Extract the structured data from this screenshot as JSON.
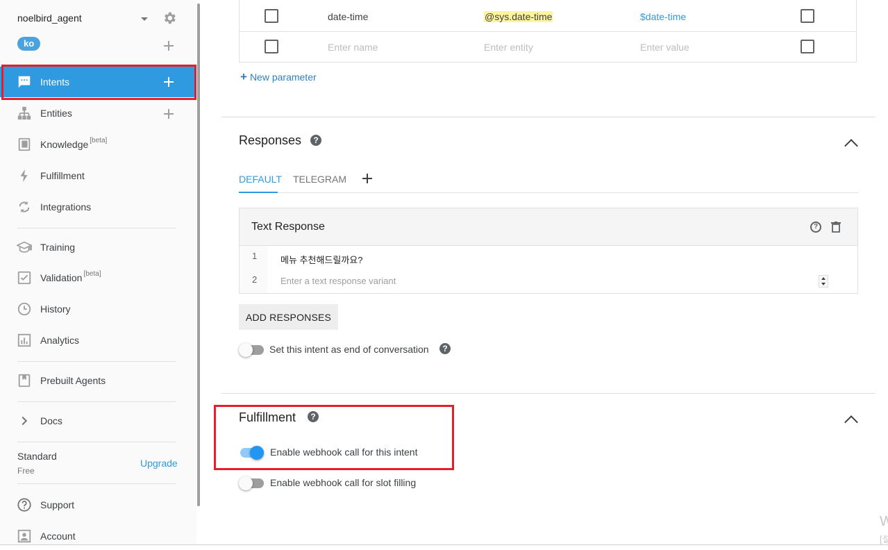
{
  "agent": {
    "name": "noelbird_agent",
    "language": "ko"
  },
  "sidebar": {
    "items": [
      {
        "label": "Intents",
        "beta": ""
      },
      {
        "label": "Entities",
        "beta": ""
      },
      {
        "label": "Knowledge",
        "beta": "[beta]"
      },
      {
        "label": "Fulfillment",
        "beta": ""
      },
      {
        "label": "Integrations",
        "beta": ""
      },
      {
        "label": "Training",
        "beta": ""
      },
      {
        "label": "Validation",
        "beta": "[beta]"
      },
      {
        "label": "History",
        "beta": ""
      },
      {
        "label": "Analytics",
        "beta": ""
      },
      {
        "label": "Prebuilt Agents",
        "beta": ""
      },
      {
        "label": "Docs",
        "beta": ""
      },
      {
        "label": "Support",
        "beta": ""
      },
      {
        "label": "Account",
        "beta": ""
      }
    ],
    "plan": {
      "name": "Standard",
      "tier": "Free",
      "upgrade_label": "Upgrade"
    }
  },
  "parameters": {
    "rows": [
      {
        "name": "date-time",
        "entity": "@sys.date-time",
        "value": "$date-time"
      }
    ],
    "placeholders": {
      "name": "Enter name",
      "entity": "Enter entity",
      "value": "Enter value"
    },
    "new_param_label": "New parameter"
  },
  "responses": {
    "title": "Responses",
    "tabs": [
      "DEFAULT",
      "TELEGRAM"
    ],
    "card_title": "Text Response",
    "lines": [
      {
        "num": "1",
        "text": "메뉴 추천해드릴까요?"
      },
      {
        "num": "2",
        "placeholder": "Enter a text response variant"
      }
    ],
    "add_button": "ADD RESPONSES",
    "end_conversation_label": "Set this intent as end of conversation"
  },
  "fulfillment": {
    "title": "Fulfillment",
    "webhook_label": "Enable webhook call for this intent",
    "webhook_enabled": true,
    "slot_filling_label": "Enable webhook call for slot filling",
    "slot_filling_enabled": false
  },
  "colors": {
    "accent": "#2f9ae0",
    "highlight_red": "#e51f2a",
    "toggle_on": "#2196f3"
  },
  "corner_glyphs": {
    "line1": "W",
    "line2": "[설"
  }
}
